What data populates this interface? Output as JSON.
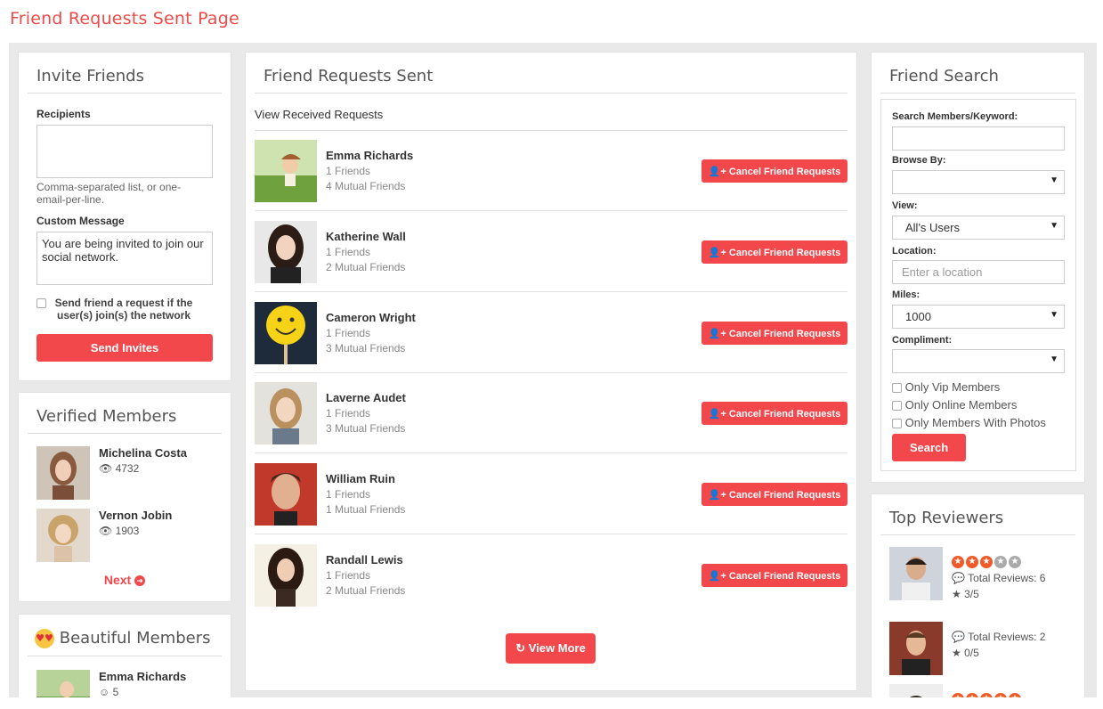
{
  "page_title": "Friend Requests Sent Page",
  "invite": {
    "title": "Invite Friends",
    "recipients_label": "Recipients",
    "recipients_value": "",
    "hint": "Comma-separated list, or one-email-per-line.",
    "custom_label": "Custom Message",
    "custom_value": "You are being invited to join our social network.",
    "checkbox_label": "Send friend a request if the user(s) join(s) the network",
    "send_button": "Send Invites"
  },
  "verified": {
    "title": "Verified Members",
    "members": [
      {
        "name": "Michelina Costa",
        "views": "4732"
      },
      {
        "name": "Vernon Jobin",
        "views": "1903"
      }
    ],
    "next_label": "Next"
  },
  "beautiful": {
    "title": "Beautiful Members",
    "members": [
      {
        "name": "Emma Richards",
        "count": "5"
      }
    ]
  },
  "requests": {
    "title": "Friend Requests Sent",
    "view_received": "View Received Requests",
    "cancel_label": "Cancel Friend Requests",
    "items": [
      {
        "name": "Emma Richards",
        "friends": "1 Friends",
        "mutual": "4 Mutual Friends"
      },
      {
        "name": "Katherine Wall",
        "friends": "1 Friends",
        "mutual": "2 Mutual Friends"
      },
      {
        "name": "Cameron Wright",
        "friends": "1 Friends",
        "mutual": "3 Mutual Friends"
      },
      {
        "name": "Laverne Audet",
        "friends": "1 Friends",
        "mutual": "3 Mutual Friends"
      },
      {
        "name": "William Ruin",
        "friends": "1 Friends",
        "mutual": "1 Mutual Friends"
      },
      {
        "name": "Randall Lewis",
        "friends": "1 Friends",
        "mutual": "2 Mutual Friends"
      }
    ],
    "view_more": "View More"
  },
  "search": {
    "title": "Friend Search",
    "keyword_label": "Search Members/Keyword:",
    "keyword_value": "",
    "browse_label": "Browse By:",
    "browse_value": "",
    "view_label": "View:",
    "view_value": "All's Users",
    "location_label": "Location:",
    "location_placeholder": "Enter a location",
    "miles_label": "Miles:",
    "miles_value": "1000",
    "compliment_label": "Compliment:",
    "compliment_value": "",
    "checks": [
      "Only Vip Members",
      "Only Online Members",
      "Only Members With Photos"
    ],
    "search_button": "Search"
  },
  "reviewers": {
    "title": "Top Reviewers",
    "items": [
      {
        "total": "Total Reviews: 6",
        "rating": "3/5",
        "stars_filled": 3
      },
      {
        "total": "Total Reviews: 2",
        "rating": "0/5",
        "stars_filled": 0
      }
    ]
  },
  "colors": {
    "accent": "#f2474b",
    "title_red": "#ef4a4a",
    "star": "#f05a28"
  }
}
